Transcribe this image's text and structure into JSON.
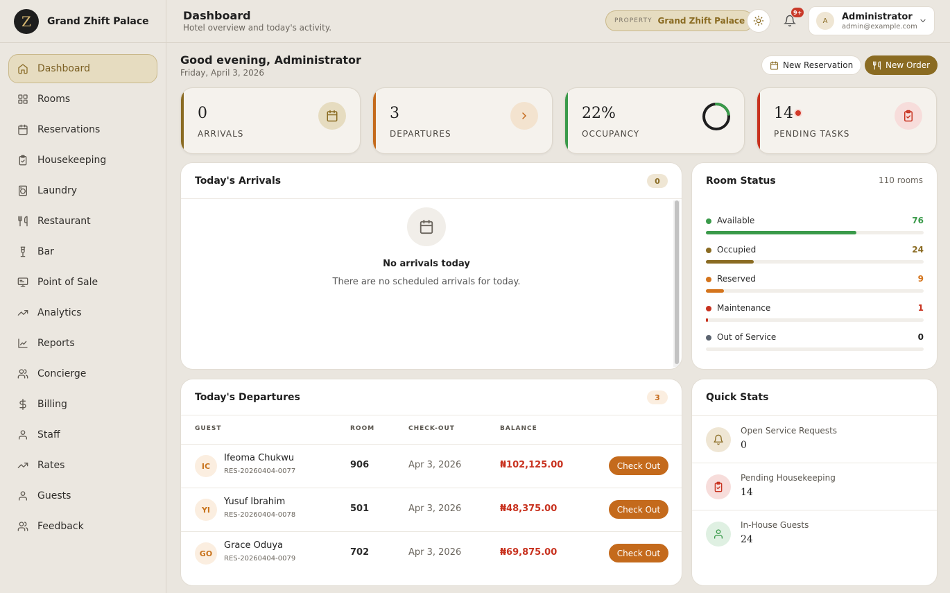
{
  "brand": {
    "logo_letter": "Z",
    "name": "Grand Zhift Palace"
  },
  "sidebar": {
    "items": [
      {
        "label": "Dashboard",
        "icon": "home-icon",
        "active": true
      },
      {
        "label": "Rooms",
        "icon": "grid-icon"
      },
      {
        "label": "Reservations",
        "icon": "calendar-icon"
      },
      {
        "label": "Housekeeping",
        "icon": "clipboard-icon"
      },
      {
        "label": "Laundry",
        "icon": "washer-icon"
      },
      {
        "label": "Restaurant",
        "icon": "utensils-icon"
      },
      {
        "label": "Bar",
        "icon": "glass-icon"
      },
      {
        "label": "Point of Sale",
        "icon": "monitor-icon"
      },
      {
        "label": "Analytics",
        "icon": "trending-icon"
      },
      {
        "label": "Reports",
        "icon": "line-chart-icon"
      },
      {
        "label": "Concierge",
        "icon": "users-icon"
      },
      {
        "label": "Billing",
        "icon": "dollar-icon"
      },
      {
        "label": "Staff",
        "icon": "user-icon"
      },
      {
        "label": "Rates",
        "icon": "trending-icon"
      },
      {
        "label": "Guests",
        "icon": "user-icon"
      },
      {
        "label": "Feedback",
        "icon": "users-icon"
      }
    ]
  },
  "header": {
    "title": "Dashboard",
    "subtitle": "Hotel overview and today's activity.",
    "property_label": "PROPERTY",
    "property_value": "Grand Zhift Palace",
    "notifications_badge": "9+",
    "user_initial": "A",
    "user_name": "Administrator",
    "user_email": "admin@example.com"
  },
  "main": {
    "greeting": "Good evening, Administrator",
    "date": "Friday, April 3, 2026",
    "new_reservation_label": "New Reservation",
    "new_order_label": "New Order"
  },
  "kpis": [
    {
      "value": "0",
      "label": "ARRIVALS",
      "color": "#8a6b22"
    },
    {
      "value": "3",
      "label": "DEPARTURES",
      "color": "#c46a1c"
    },
    {
      "value": "22%",
      "label": "OCCUPANCY",
      "color": "#3a9a4a",
      "ring_fraction": 0.22
    },
    {
      "value": "14",
      "label": "PENDING TASKS",
      "color": "#c8321f"
    }
  ],
  "arrivals": {
    "title": "Today's Arrivals",
    "count": "0",
    "empty_title": "No arrivals today",
    "empty_subtitle": "There are no scheduled arrivals for today."
  },
  "room_status": {
    "title": "Room Status",
    "total_label": "110 rooms",
    "total": 110,
    "items": [
      {
        "label": "Available",
        "value": "76",
        "count": 76,
        "color": "#3a9a4a"
      },
      {
        "label": "Occupied",
        "value": "24",
        "count": 24,
        "color": "#8a6b22"
      },
      {
        "label": "Reserved",
        "value": "9",
        "count": 9,
        "color": "#d4741c"
      },
      {
        "label": "Maintenance",
        "value": "1",
        "count": 1,
        "color": "#c8321f"
      },
      {
        "label": "Out of Service",
        "value": "0",
        "count": 0,
        "color": "#5c6470"
      }
    ]
  },
  "departures": {
    "title": "Today's Departures",
    "count": "3",
    "columns": [
      "GUEST",
      "ROOM",
      "CHECK-OUT",
      "BALANCE"
    ],
    "action_label": "Check Out",
    "rows": [
      {
        "initials": "IC",
        "name": "Ifeoma Chukwu",
        "res": "RES-20260404-0077",
        "room": "906",
        "checkout": "Apr 3, 2026",
        "balance": "₦102,125.00"
      },
      {
        "initials": "YI",
        "name": "Yusuf Ibrahim",
        "res": "RES-20260404-0078",
        "room": "501",
        "checkout": "Apr 3, 2026",
        "balance": "₦48,375.00"
      },
      {
        "initials": "GO",
        "name": "Grace Oduya",
        "res": "RES-20260404-0079",
        "room": "702",
        "checkout": "Apr 3, 2026",
        "balance": "₦69,875.00"
      }
    ]
  },
  "quick_stats": {
    "title": "Quick Stats",
    "items": [
      {
        "label": "Open Service Requests",
        "value": "0",
        "icon": "bell-icon"
      },
      {
        "label": "Pending Housekeeping",
        "value": "14",
        "icon": "clipboard-icon"
      },
      {
        "label": "In-House Guests",
        "value": "24",
        "icon": "user-icon"
      }
    ]
  }
}
